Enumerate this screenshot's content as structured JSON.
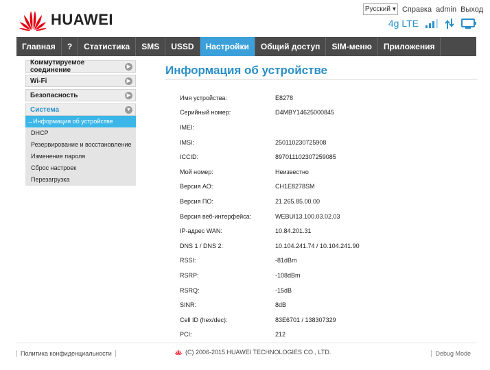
{
  "brand": {
    "name": "HUAWEI"
  },
  "topbar": {
    "language": "Русский",
    "help": "Справка",
    "user": "admin",
    "logout": "Выход"
  },
  "status": {
    "network_type": "4g LTE",
    "signal_icon": "signal-bars-icon",
    "transfer_icon": "up-down-arrows-icon",
    "monitor_icon": "monitor-icon"
  },
  "nav": {
    "items": [
      "Главная",
      "?",
      "Статистика",
      "SMS",
      "USSD",
      "Настройки",
      "Общий доступ",
      "SIM-меню",
      "Приложения"
    ],
    "active": "Настройки"
  },
  "sidebar": {
    "sections": [
      "Коммутируемое соединение",
      "Wi-Fi",
      "Безопасность"
    ],
    "system": {
      "label": "Система",
      "items": [
        "→Информация об устройстве",
        "DHCP",
        "Резервирование и восстановление",
        "Изменение пароля",
        "Сброс настроек",
        "Перезагрузка"
      ]
    }
  },
  "main": {
    "title": "Информация об устройстве",
    "rows": [
      {
        "label": "Имя устройства:",
        "value": "E8278"
      },
      {
        "label": "Серийный номер:",
        "value": "D4MBY14625000845"
      },
      {
        "label": "IMEI:",
        "value": ""
      },
      {
        "label": "IMSI:",
        "value": "250110230725908"
      },
      {
        "label": "ICCID:",
        "value": "897011102307259085"
      },
      {
        "label": "Мой номер:",
        "value": "Неизвестно"
      },
      {
        "label": "Версия АО:",
        "value": "CH1E8278SM"
      },
      {
        "label": "Версия ПО:",
        "value": "21.265.85.00.00"
      },
      {
        "label": "Версия веб-интерфейса:",
        "value": "WEBUI13.100.03.02.03"
      },
      {
        "label": "IP-адрес WAN:",
        "value": "10.84.201.31"
      },
      {
        "label": "DNS 1 / DNS 2:",
        "value": "10.104.241.74 / 10.104.241.90"
      },
      {
        "label": "RSSI:",
        "value": "-81dBm"
      },
      {
        "label": "RSRP:",
        "value": "-108dBm"
      },
      {
        "label": "RSRQ:",
        "value": "-15dB"
      },
      {
        "label": "SINR:",
        "value": "8dB"
      },
      {
        "label": "Cell ID (hex/dec):",
        "value": "83E6701 / 138307329"
      },
      {
        "label": "PCI:",
        "value": "212"
      }
    ]
  },
  "footer": {
    "privacy": "Политика конфиденциальности",
    "copyright": "(C) 2006-2015 HUAWEI TECHNOLOGIES CO., LTD.",
    "corner_text": "Debug Mode"
  },
  "colors": {
    "accent": "#2a8fc7",
    "nav_bg": "#4a4a4a",
    "nav_active": "#3ba0d9",
    "sidebar_active": "#3bb6e8",
    "brand_red": "#e60012"
  }
}
